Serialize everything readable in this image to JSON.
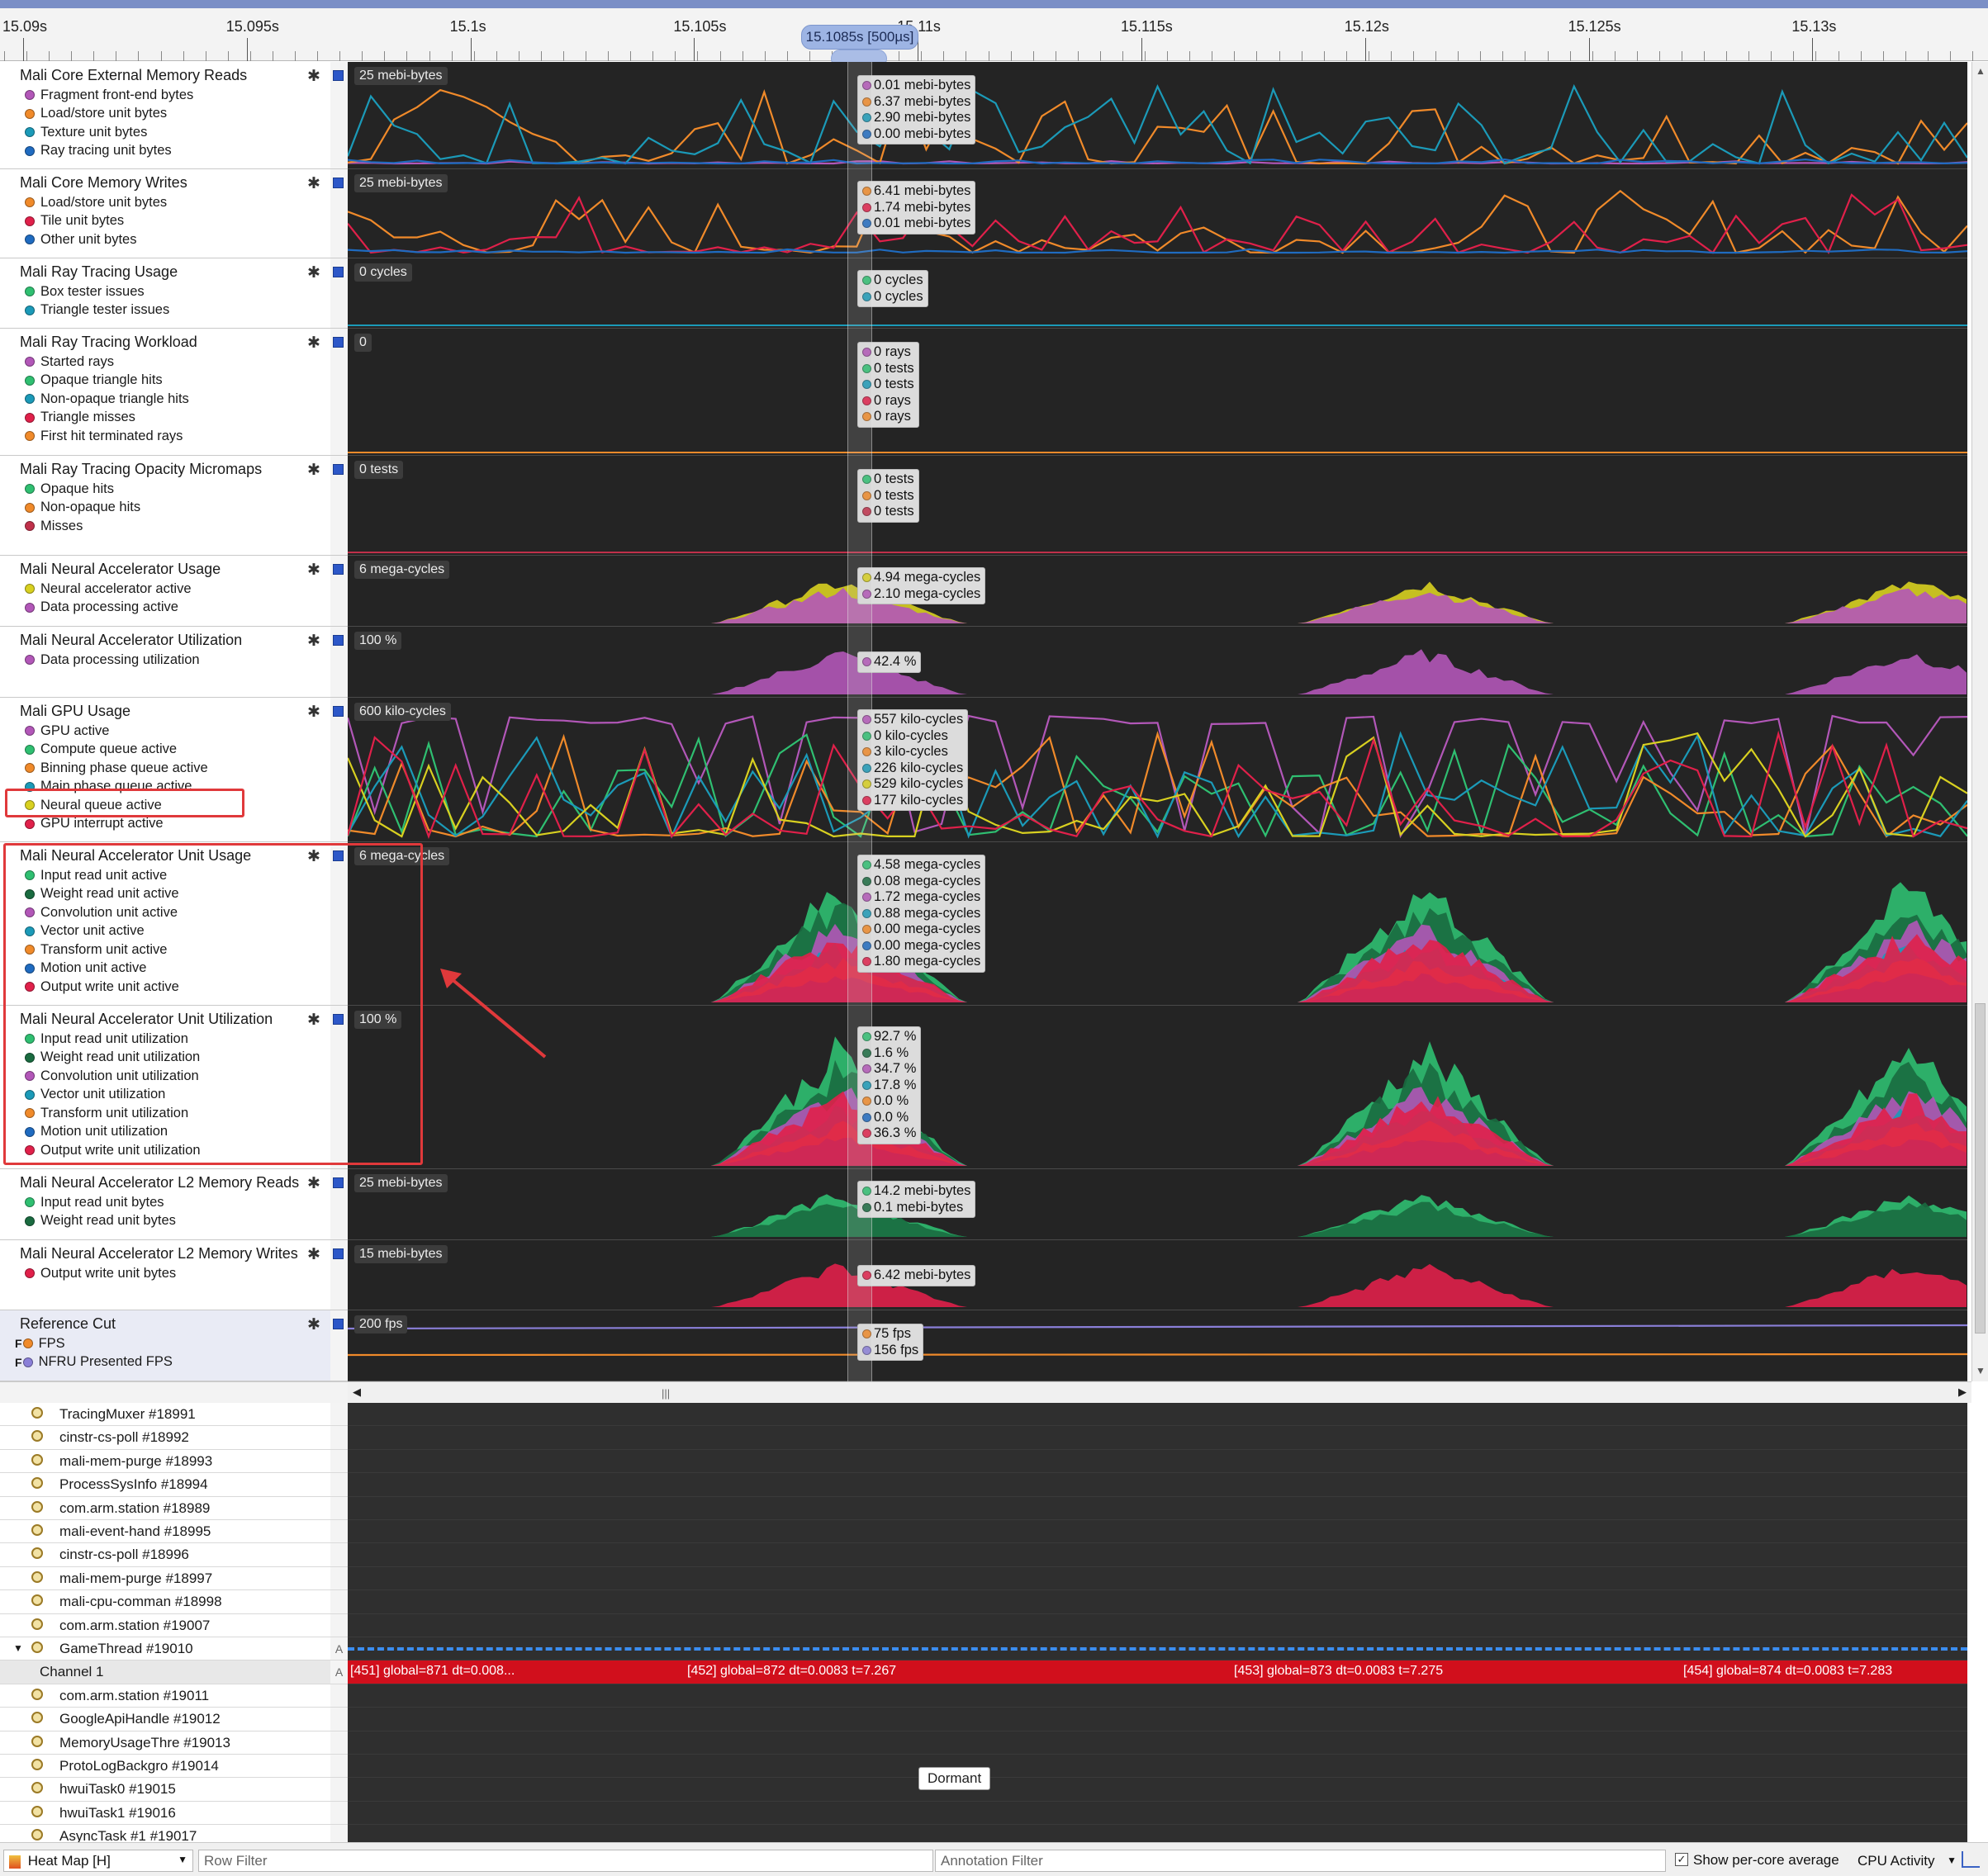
{
  "ruler": {
    "ticks": [
      "15.09s",
      "15.095s",
      "15.1s",
      "15.105s",
      "15.11s",
      "15.115s",
      "15.12s",
      "15.125s",
      "15.13s"
    ],
    "cursor_label": "15.1085s [500µs]"
  },
  "rows": [
    {
      "title": "Mali Core External Memory Reads",
      "scale": "25 mebi-bytes",
      "series": [
        {
          "name": "Fragment front-end bytes",
          "color": "#b257b8"
        },
        {
          "name": "Load/store unit bytes",
          "color": "#f08a2a"
        },
        {
          "name": "Texture unit bytes",
          "color": "#1b9ab8"
        },
        {
          "name": "Ray tracing unit bytes",
          "color": "#1f6bc0"
        }
      ],
      "tooltip": [
        {
          "value": "0.01 mebi-bytes",
          "color": "#b257b8"
        },
        {
          "value": "6.37 mebi-bytes",
          "color": "#f08a2a"
        },
        {
          "value": "2.90 mebi-bytes",
          "color": "#1b9ab8"
        },
        {
          "value": "0.00 mebi-bytes",
          "color": "#1f6bc0"
        }
      ]
    },
    {
      "title": "Mali Core Memory Writes",
      "scale": "25 mebi-bytes",
      "series": [
        {
          "name": "Load/store unit bytes",
          "color": "#f08a2a"
        },
        {
          "name": "Tile unit bytes",
          "color": "#e0204a"
        },
        {
          "name": "Other unit bytes",
          "color": "#1f6bc0"
        }
      ],
      "tooltip": [
        {
          "value": "6.41 mebi-bytes",
          "color": "#f08a2a"
        },
        {
          "value": "1.74 mebi-bytes",
          "color": "#e0204a"
        },
        {
          "value": "0.01 mebi-bytes",
          "color": "#1f6bc0"
        }
      ]
    },
    {
      "title": "Mali Ray Tracing Usage",
      "scale": "0 cycles",
      "series": [
        {
          "name": "Box tester issues",
          "color": "#2fbf71"
        },
        {
          "name": "Triangle tester issues",
          "color": "#1b9ab8"
        }
      ],
      "tooltip": [
        {
          "value": "0 cycles",
          "color": "#2fbf71"
        },
        {
          "value": "0 cycles",
          "color": "#1b9ab8"
        }
      ]
    },
    {
      "title": "Mali Ray Tracing Workload",
      "scale": "0",
      "series": [
        {
          "name": "Started rays",
          "color": "#b257b8"
        },
        {
          "name": "Opaque triangle hits",
          "color": "#2fbf71"
        },
        {
          "name": "Non-opaque triangle hits",
          "color": "#1b9ab8"
        },
        {
          "name": "Triangle misses",
          "color": "#e0204a"
        },
        {
          "name": "First hit terminated rays",
          "color": "#f08a2a"
        }
      ],
      "tooltip": [
        {
          "value": "0 rays",
          "color": "#b257b8"
        },
        {
          "value": "0 tests",
          "color": "#2fbf71"
        },
        {
          "value": "0 tests",
          "color": "#1b9ab8"
        },
        {
          "value": "0 rays",
          "color": "#e0204a"
        },
        {
          "value": "0 rays",
          "color": "#f08a2a"
        }
      ]
    },
    {
      "title": "Mali Ray Tracing Opacity Micromaps",
      "scale": "0 tests",
      "series": [
        {
          "name": "Opaque hits",
          "color": "#2fbf71"
        },
        {
          "name": "Non-opaque hits",
          "color": "#f08a2a"
        },
        {
          "name": "Misses",
          "color": "#c0304a"
        }
      ],
      "tooltip": [
        {
          "value": "0 tests",
          "color": "#2fbf71"
        },
        {
          "value": "0 tests",
          "color": "#f08a2a"
        },
        {
          "value": "0 tests",
          "color": "#c0304a"
        }
      ]
    },
    {
      "title": "Mali Neural Accelerator Usage",
      "scale": "6 mega-cycles",
      "series": [
        {
          "name": "Neural accelerator active",
          "color": "#d8d020"
        },
        {
          "name": "Data processing active",
          "color": "#b257b8"
        }
      ],
      "tooltip": [
        {
          "value": "4.94 mega-cycles",
          "color": "#d8d020"
        },
        {
          "value": "2.10 mega-cycles",
          "color": "#b257b8"
        }
      ]
    },
    {
      "title": "Mali Neural Accelerator Utilization",
      "scale": "100 %",
      "series": [
        {
          "name": "Data processing utilization",
          "color": "#b257b8"
        }
      ],
      "tooltip": [
        {
          "value": "42.4 %",
          "color": "#b257b8"
        }
      ]
    },
    {
      "title": "Mali GPU Usage",
      "scale": "600 kilo-cycles",
      "series": [
        {
          "name": "GPU active",
          "color": "#b257b8"
        },
        {
          "name": "Compute queue active",
          "color": "#2fbf71"
        },
        {
          "name": "Binning phase queue active",
          "color": "#f08a2a"
        },
        {
          "name": "Main phase queue active",
          "color": "#1b9ab8"
        },
        {
          "name": "Neural queue active",
          "color": "#d8d020"
        },
        {
          "name": "GPU interrupt active",
          "color": "#e0204a"
        }
      ],
      "tooltip": [
        {
          "value": "557 kilo-cycles",
          "color": "#b257b8"
        },
        {
          "value": "0 kilo-cycles",
          "color": "#2fbf71"
        },
        {
          "value": "3 kilo-cycles",
          "color": "#f08a2a"
        },
        {
          "value": "226 kilo-cycles",
          "color": "#1b9ab8"
        },
        {
          "value": "529 kilo-cycles",
          "color": "#d8d020"
        },
        {
          "value": "177 kilo-cycles",
          "color": "#e0204a"
        }
      ]
    },
    {
      "title": "Mali Neural Accelerator Unit Usage",
      "scale": "6 mega-cycles",
      "series": [
        {
          "name": "Input read unit active",
          "color": "#2fbf71"
        },
        {
          "name": "Weight read unit active",
          "color": "#1a6b40"
        },
        {
          "name": "Convolution unit active",
          "color": "#b257b8"
        },
        {
          "name": "Vector unit active",
          "color": "#1b9ab8"
        },
        {
          "name": "Transform unit active",
          "color": "#f08a2a"
        },
        {
          "name": "Motion unit active",
          "color": "#1f6bc0"
        },
        {
          "name": "Output write unit active",
          "color": "#e0204a"
        }
      ],
      "tooltip": [
        {
          "value": "4.58 mega-cycles",
          "color": "#2fbf71"
        },
        {
          "value": "0.08 mega-cycles",
          "color": "#1a6b40"
        },
        {
          "value": "1.72 mega-cycles",
          "color": "#b257b8"
        },
        {
          "value": "0.88 mega-cycles",
          "color": "#1b9ab8"
        },
        {
          "value": "0.00 mega-cycles",
          "color": "#f08a2a"
        },
        {
          "value": "0.00 mega-cycles",
          "color": "#1f6bc0"
        },
        {
          "value": "1.80 mega-cycles",
          "color": "#e0204a"
        }
      ]
    },
    {
      "title": "Mali Neural Accelerator Unit Utilization",
      "scale": "100 %",
      "series": [
        {
          "name": "Input read unit utilization",
          "color": "#2fbf71"
        },
        {
          "name": "Weight read unit utilization",
          "color": "#1a6b40"
        },
        {
          "name": "Convolution unit utilization",
          "color": "#b257b8"
        },
        {
          "name": "Vector unit utilization",
          "color": "#1b9ab8"
        },
        {
          "name": "Transform unit utilization",
          "color": "#f08a2a"
        },
        {
          "name": "Motion unit utilization",
          "color": "#1f6bc0"
        },
        {
          "name": "Output write unit utilization",
          "color": "#e0204a"
        }
      ],
      "tooltip": [
        {
          "value": "92.7 %",
          "color": "#2fbf71"
        },
        {
          "value": "1.6 %",
          "color": "#1a6b40"
        },
        {
          "value": "34.7 %",
          "color": "#b257b8"
        },
        {
          "value": "17.8 %",
          "color": "#1b9ab8"
        },
        {
          "value": "0.0 %",
          "color": "#f08a2a"
        },
        {
          "value": "0.0 %",
          "color": "#1f6bc0"
        },
        {
          "value": "36.3 %",
          "color": "#e0204a"
        }
      ]
    },
    {
      "title": "Mali Neural Accelerator L2 Memory Reads",
      "scale": "25 mebi-bytes",
      "series": [
        {
          "name": "Input read unit bytes",
          "color": "#2fbf71"
        },
        {
          "name": "Weight read unit bytes",
          "color": "#1a6b40"
        }
      ],
      "tooltip": [
        {
          "value": "14.2 mebi-bytes",
          "color": "#2fbf71"
        },
        {
          "value": "0.1 mebi-bytes",
          "color": "#1a6b40"
        }
      ]
    },
    {
      "title": "Mali Neural Accelerator L2 Memory Writes",
      "scale": "15 mebi-bytes",
      "series": [
        {
          "name": "Output write unit bytes",
          "color": "#e0204a"
        }
      ],
      "tooltip": [
        {
          "value": "6.42 mebi-bytes",
          "color": "#e0204a"
        }
      ]
    },
    {
      "title": "Reference Cut",
      "scale": "200 fps",
      "series": [
        {
          "name": "FPS",
          "color": "#f08a2a",
          "prefix": "F"
        },
        {
          "name": "NFRU Presented FPS",
          "color": "#8a7fd8",
          "prefix": "F"
        }
      ],
      "tooltip": [
        {
          "value": "75 fps",
          "color": "#f08a2a"
        },
        {
          "value": "156 fps",
          "color": "#8a7fd8"
        }
      ]
    }
  ],
  "threads": [
    {
      "name": "TracingMuxer #18991"
    },
    {
      "name": "cinstr-cs-poll #18992"
    },
    {
      "name": "mali-mem-purge #18993"
    },
    {
      "name": "ProcessSysInfo #18994"
    },
    {
      "name": "com.arm.station #18989"
    },
    {
      "name": "mali-event-hand #18995"
    },
    {
      "name": "cinstr-cs-poll #18996"
    },
    {
      "name": "mali-mem-purge #18997"
    },
    {
      "name": "mali-cpu-comman #18998"
    },
    {
      "name": "com.arm.station #19007"
    },
    {
      "name": "GameThread #19010",
      "expanded": true,
      "gutter": "A"
    },
    {
      "name": "Channel 1",
      "channel": true,
      "gutter": "A"
    },
    {
      "name": "com.arm.station #19011"
    },
    {
      "name": "GoogleApiHandle #19012"
    },
    {
      "name": "MemoryUsageThre #19013"
    },
    {
      "name": "ProtoLogBackgro #19014"
    },
    {
      "name": "hwuiTask0 #19015"
    },
    {
      "name": "hwuiTask1 #19016"
    },
    {
      "name": "AsyncTask #1 #19017"
    }
  ],
  "channel_annotations": [
    "[451] global=871 dt=0.008...",
    "[452] global=872 dt=0.0083 t=7.267",
    "[453] global=873 dt=0.0083 t=7.275",
    "[454] global=874 dt=0.0083 t=7.283"
  ],
  "dormant_label": "Dormant",
  "bottom": {
    "heatmap": "Heat Map [H]",
    "row_filter": "Row Filter",
    "annotation_filter": "Annotation Filter",
    "per_core_label": "Show per-core average",
    "cpu_activity": "CPU Activity"
  },
  "colors": {
    "accent": "#2c57c8",
    "highlight_box": "#e0393b",
    "plot_bg": "#242424",
    "channel_bar": "#d10f1c"
  }
}
